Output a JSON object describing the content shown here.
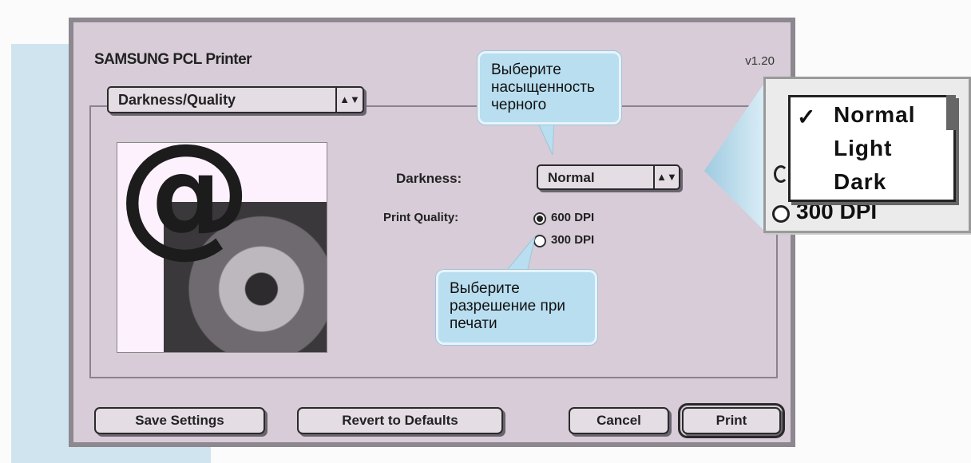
{
  "dialog": {
    "title": "SAMSUNG PCL Printer",
    "version": "v1.20",
    "section_select": "Darkness/Quality"
  },
  "settings": {
    "darkness_label": "Darkness:",
    "darkness_value": "Normal",
    "print_quality_label": "Print Quality:",
    "quality_options": [
      "600 DPI",
      "300 DPI"
    ],
    "quality_selected": "600 DPI"
  },
  "buttons": {
    "save": "Save Settings",
    "revert": "Revert to Defaults",
    "cancel": "Cancel",
    "print": "Print"
  },
  "callouts": {
    "darkness_hint": "Выберите насыщенность черного",
    "resolution_hint": "Выберите разрешение при печати"
  },
  "zoom_menu": {
    "items": [
      "Normal",
      "Light",
      "Dark"
    ],
    "checked": "Normal",
    "partial_radio_label": "300 DPI"
  },
  "colors": {
    "dialog_bg": "#d7ccd7",
    "callout_bg": "#b9def0",
    "side_strip": "#cfe4ef"
  },
  "icons": {
    "popup_arrows": "up-down-arrows-icon",
    "check": "checkmark-icon",
    "sample_image": "at-sign-flower-image"
  }
}
